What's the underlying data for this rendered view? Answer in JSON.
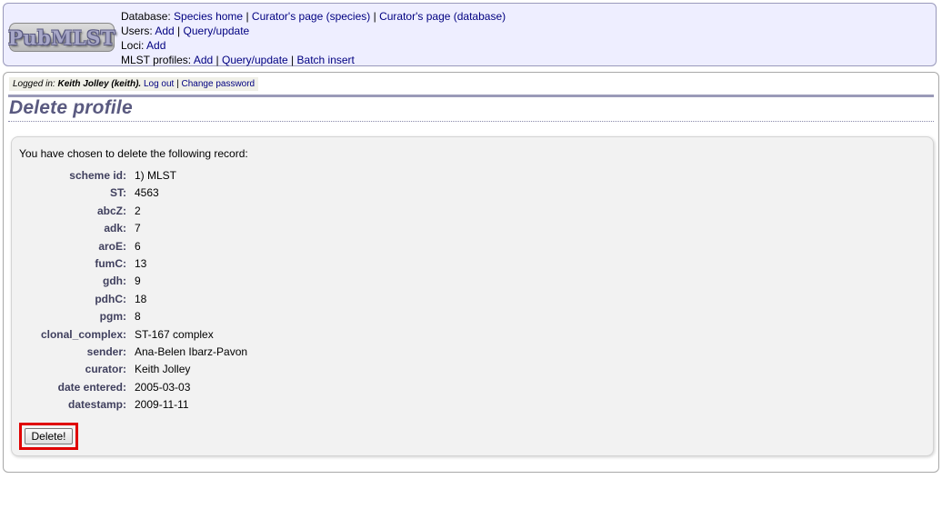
{
  "header": {
    "logo_text": "PubMLST",
    "database": {
      "label": "Database:",
      "links": [
        "Species home",
        "Curator's page (species)",
        "Curator's page (database)"
      ]
    },
    "users": {
      "label": "Users:",
      "links": [
        "Add",
        "Query/update"
      ]
    },
    "loci": {
      "label": "Loci:",
      "links": [
        "Add"
      ]
    },
    "mlst_profiles": {
      "label": "MLST profiles:",
      "links": [
        "Add",
        "Query/update",
        "Batch insert"
      ]
    },
    "separator": "|"
  },
  "login": {
    "prefix": "Logged in:",
    "user": "Keith Jolley (keith).",
    "logout": "Log out",
    "change_password": "Change password"
  },
  "page_title": "Delete profile",
  "intro": "You have chosen to delete the following record:",
  "record": [
    {
      "label": "scheme id:",
      "value": "1) MLST"
    },
    {
      "label": "ST:",
      "value": "4563"
    },
    {
      "label": "abcZ:",
      "value": "2"
    },
    {
      "label": "adk:",
      "value": "7"
    },
    {
      "label": "aroE:",
      "value": "6"
    },
    {
      "label": "fumC:",
      "value": "13"
    },
    {
      "label": "gdh:",
      "value": "9"
    },
    {
      "label": "pdhC:",
      "value": "18"
    },
    {
      "label": "pgm:",
      "value": "8"
    },
    {
      "label": "clonal_complex:",
      "value": "ST-167 complex"
    },
    {
      "label": "sender:",
      "value": "Ana-Belen Ibarz-Pavon"
    },
    {
      "label": "curator:",
      "value": "Keith Jolley"
    },
    {
      "label": "date entered:",
      "value": "2005-03-03"
    },
    {
      "label": "datestamp:",
      "value": "2009-11-11"
    }
  ],
  "delete_button": "Delete!",
  "colors": {
    "header_bg": "#eeeeff",
    "link": "#000080",
    "title": "#5a5a80",
    "label": "#40405e",
    "highlight": "#e00000"
  }
}
